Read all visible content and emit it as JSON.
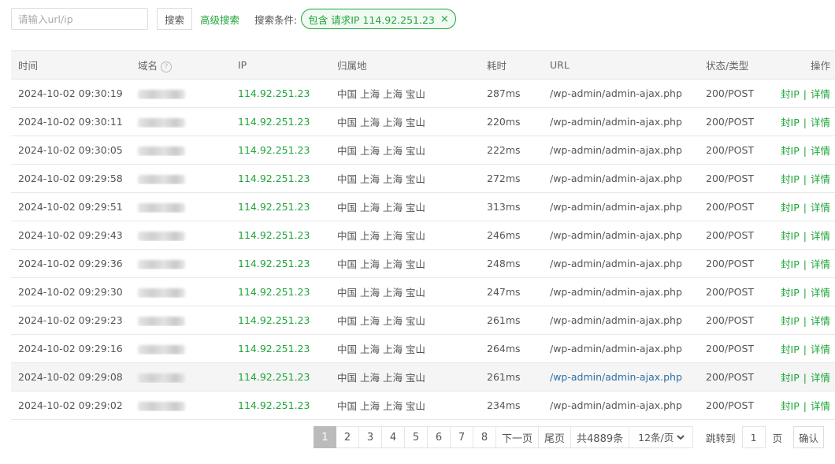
{
  "toolbar": {
    "search_placeholder": "请输入url/ip",
    "search_button": "搜索",
    "advanced_search": "高级搜索",
    "condition_label": "搜索条件:",
    "condition_tag": "包含 请求IP 114.92.251.23",
    "condition_close": "×"
  },
  "table": {
    "headers": {
      "time": "时间",
      "domain": "域名",
      "ip": "IP",
      "location": "归属地",
      "duration": "耗时",
      "url": "URL",
      "status": "状态/类型",
      "ops": "操作"
    },
    "rows": [
      {
        "time": "2024-10-02 09:30:19",
        "ip": "114.92.251.23",
        "location": "中国 上海 上海 宝山",
        "duration": "287ms",
        "url": "/wp-admin/admin-ajax.php",
        "status": "200/POST"
      },
      {
        "time": "2024-10-02 09:30:11",
        "ip": "114.92.251.23",
        "location": "中国 上海 上海 宝山",
        "duration": "220ms",
        "url": "/wp-admin/admin-ajax.php",
        "status": "200/POST"
      },
      {
        "time": "2024-10-02 09:30:05",
        "ip": "114.92.251.23",
        "location": "中国 上海 上海 宝山",
        "duration": "222ms",
        "url": "/wp-admin/admin-ajax.php",
        "status": "200/POST"
      },
      {
        "time": "2024-10-02 09:29:58",
        "ip": "114.92.251.23",
        "location": "中国 上海 上海 宝山",
        "duration": "272ms",
        "url": "/wp-admin/admin-ajax.php",
        "status": "200/POST"
      },
      {
        "time": "2024-10-02 09:29:51",
        "ip": "114.92.251.23",
        "location": "中国 上海 上海 宝山",
        "duration": "313ms",
        "url": "/wp-admin/admin-ajax.php",
        "status": "200/POST"
      },
      {
        "time": "2024-10-02 09:29:43",
        "ip": "114.92.251.23",
        "location": "中国 上海 上海 宝山",
        "duration": "246ms",
        "url": "/wp-admin/admin-ajax.php",
        "status": "200/POST"
      },
      {
        "time": "2024-10-02 09:29:36",
        "ip": "114.92.251.23",
        "location": "中国 上海 上海 宝山",
        "duration": "248ms",
        "url": "/wp-admin/admin-ajax.php",
        "status": "200/POST"
      },
      {
        "time": "2024-10-02 09:29:30",
        "ip": "114.92.251.23",
        "location": "中国 上海 上海 宝山",
        "duration": "247ms",
        "url": "/wp-admin/admin-ajax.php",
        "status": "200/POST"
      },
      {
        "time": "2024-10-02 09:29:23",
        "ip": "114.92.251.23",
        "location": "中国 上海 上海 宝山",
        "duration": "261ms",
        "url": "/wp-admin/admin-ajax.php",
        "status": "200/POST"
      },
      {
        "time": "2024-10-02 09:29:16",
        "ip": "114.92.251.23",
        "location": "中国 上海 上海 宝山",
        "duration": "264ms",
        "url": "/wp-admin/admin-ajax.php",
        "status": "200/POST"
      },
      {
        "time": "2024-10-02 09:29:08",
        "ip": "114.92.251.23",
        "location": "中国 上海 上海 宝山",
        "duration": "261ms",
        "url": "/wp-admin/admin-ajax.php",
        "status": "200/POST"
      },
      {
        "time": "2024-10-02 09:29:02",
        "ip": "114.92.251.23",
        "location": "中国 上海 上海 宝山",
        "duration": "234ms",
        "url": "/wp-admin/admin-ajax.php",
        "status": "200/POST"
      }
    ],
    "ops": {
      "block_ip": "封IP",
      "separator": "|",
      "details": "详情"
    }
  },
  "pagination": {
    "pages": [
      "1",
      "2",
      "3",
      "4",
      "5",
      "6",
      "7",
      "8"
    ],
    "current": "1",
    "next": "下一页",
    "last": "尾页",
    "total": "共4889条",
    "per_page": "12条/页",
    "jump_label": "跳转到",
    "jump_value": "1",
    "page_unit": "页",
    "confirm": "确认"
  },
  "colors": {
    "accent": "#20a53a",
    "link": "#2d6ea5",
    "active_page": "#bbbbbb"
  }
}
